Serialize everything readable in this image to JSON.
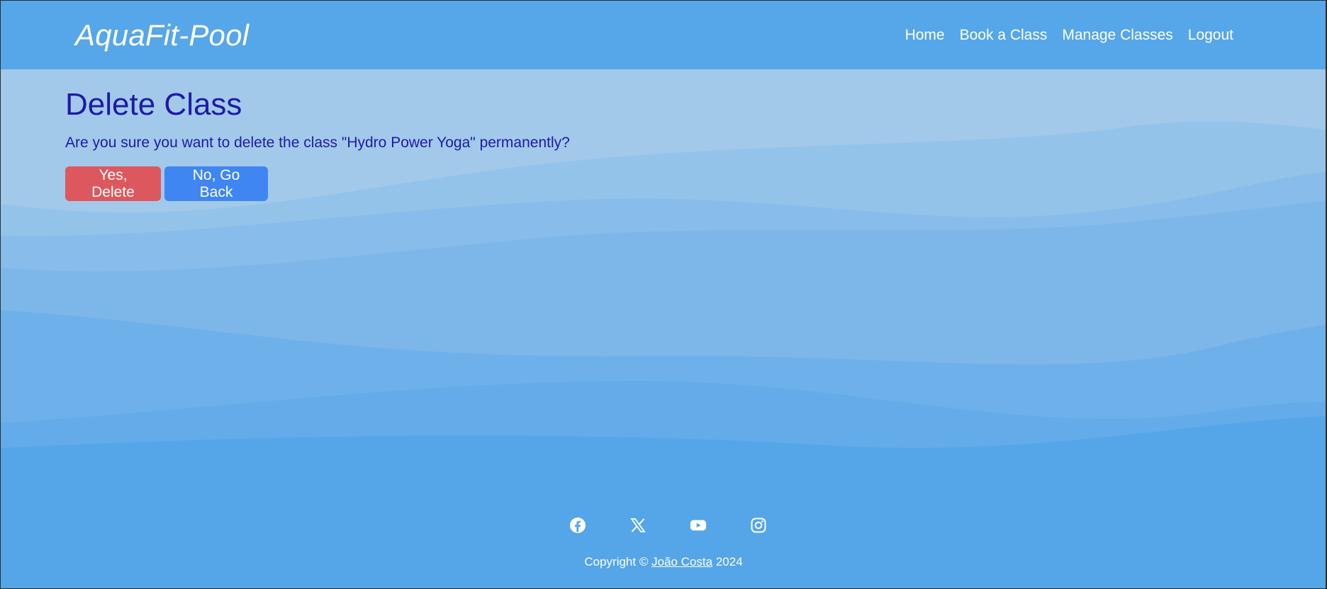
{
  "header": {
    "brand": "AquaFit-Pool",
    "nav": [
      {
        "label": "Home"
      },
      {
        "label": "Book a Class"
      },
      {
        "label": "Manage Classes"
      },
      {
        "label": "Logout"
      }
    ]
  },
  "main": {
    "title": "Delete Class",
    "confirm_text": "Are you sure you want to delete the class \"Hydro Power Yoga\" permanently?",
    "delete_label": "Yes, Delete",
    "back_label": "No, Go Back"
  },
  "footer": {
    "socials": [
      "facebook-icon",
      "x-icon",
      "youtube-icon",
      "instagram-icon"
    ],
    "copyright_prefix": "Copyright ©",
    "author": "João Costa",
    "year": "2024"
  },
  "colors": {
    "header_bg": "#56a6ea",
    "heading_text": "#1e1aa8",
    "delete_button": "#dc585e",
    "back_button": "#3f86f2",
    "footer_bg": "#55a5e9"
  }
}
